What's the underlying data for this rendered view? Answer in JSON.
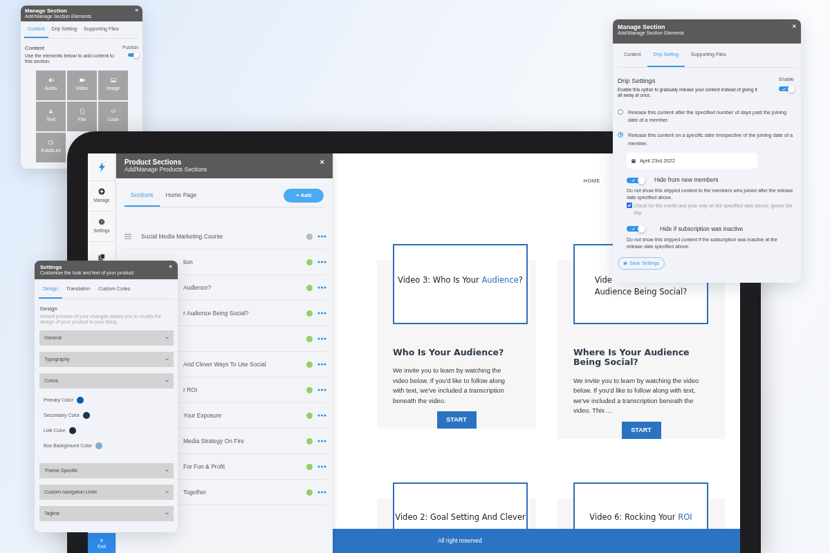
{
  "manage_section_small": {
    "title": "Manage Section",
    "subtitle": "Add/Manage Section Elements",
    "close": "×",
    "tabs": [
      {
        "label": "Content",
        "selected": true
      },
      {
        "label": "Drip Setting",
        "selected": false
      },
      {
        "label": "Supporting Files",
        "selected": false
      }
    ],
    "heading": "Content",
    "description": "Use the elements below to add content to this section.",
    "publish_label": "Publish",
    "published": true,
    "elements": [
      {
        "label": "Audio",
        "kind": "audio"
      },
      {
        "label": "Video",
        "kind": "video"
      },
      {
        "label": "Image",
        "kind": "image"
      },
      {
        "label": "Text",
        "kind": "text",
        "glyph": "A"
      },
      {
        "label": "File",
        "kind": "file"
      },
      {
        "label": "Code",
        "kind": "code"
      },
      {
        "label": "KuickList",
        "kind": "kuicklist"
      }
    ]
  },
  "app_sidebar": {
    "items": [
      {
        "label": "Manage",
        "kind": "manage"
      },
      {
        "label": "Settings",
        "kind": "settings"
      },
      {
        "kind": "pages"
      }
    ],
    "exit": {
      "icon": "×",
      "label": "Exit"
    }
  },
  "product_sections": {
    "title": "Product Sections",
    "subtitle": "Add/Manage Products Sections",
    "close": "×",
    "tabs": [
      {
        "label": "Sections",
        "selected": true
      },
      {
        "label": "Home Page",
        "selected": false
      }
    ],
    "add_button": "+ Add",
    "rows": [
      {
        "text": "Social Media Marketing Course",
        "handle": true,
        "color": "#b9b9b9"
      },
      {
        "text": "tion",
        "handle": false,
        "color": "#8fd16a"
      },
      {
        "text": "Audience?",
        "handle": false,
        "color": "#8fd16a"
      },
      {
        "text": "r Audience Being Social?",
        "handle": false,
        "color": "#8fd16a"
      },
      {
        "handle": false,
        "color": "#8fd16a"
      },
      {
        "text": "And Clever Ways To Use Social",
        "handle": false,
        "color": "#8fd16a"
      },
      {
        "text": "r ROI",
        "handle": false,
        "color": "#8fd16a"
      },
      {
        "text": "Your Exposure",
        "handle": false,
        "color": "#8fd16a"
      },
      {
        "text": "Media Strategy On Fire",
        "handle": false,
        "color": "#8fd16a"
      },
      {
        "text": "For Fun & Profit",
        "handle": false,
        "color": "#8fd16a"
      },
      {
        "text": "Together",
        "handle": false,
        "color": "#8fd16a"
      }
    ]
  },
  "site": {
    "nav": [
      "HOME"
    ],
    "cards": [
      {
        "video_title": [
          [
            {
              "text": "Video 3: Who Is Your "
            },
            {
              "text": "Audience",
              "link": true
            },
            {
              "text": "?"
            }
          ]
        ],
        "title": "Who Is Your Audience?",
        "body": "We invite you to learn by watching the video below. If you'd like to follow along with text, we've included a transcription beneath the video.",
        "button": "START"
      },
      {
        "video_title": [
          [
            {
              "text": "Vide"
            }
          ],
          [
            {
              "text": "Audience Being Social?"
            }
          ]
        ],
        "title": "Where Is Your Audience Being Social?",
        "body": "We invite you to learn by watching the video below. If you'd like to follow along with text, we've included a transcription beneath the video. This ...",
        "button": "START"
      }
    ],
    "more_cards": [
      {
        "video_title": [
          [
            {
              "text": "Video 2: Goal Setting And Clever"
            }
          ]
        ]
      },
      {
        "video_title": [
          [
            {
              "text": "Video 6: Rocking Your "
            },
            {
              "text": "ROI",
              "link": true
            }
          ]
        ]
      }
    ],
    "footer": "All right reserved"
  },
  "settings_panel": {
    "title": "Settings",
    "subtitle": "Customize the look and feel of your product",
    "close": "×",
    "tabs": [
      {
        "label": "Design",
        "selected": true
      },
      {
        "label": "Translation",
        "selected": false
      },
      {
        "label": "Custom Codes",
        "selected": false
      }
    ],
    "heading": "Design",
    "description": "Instant preview of your changes allows you to modify the design of your product to your liking.",
    "sections": [
      {
        "label": "General"
      },
      {
        "label": "Typography"
      },
      {
        "label": "Colors",
        "colors": [
          {
            "label": "Primary Color",
            "color": "#0b5cb5"
          },
          {
            "label": "Secondary Color",
            "color": "#1e3450"
          },
          {
            "label": "Link Color",
            "color": "#1c2a3a"
          },
          {
            "label": "Box Background Color",
            "color": "#82abd2"
          }
        ]
      },
      {
        "label": "Theme Specific"
      },
      {
        "label": "Custom navigation Links"
      },
      {
        "label": "Tagline"
      }
    ]
  },
  "drip_panel": {
    "title": "Manage Section",
    "subtitle": "Add/Manage Section Elements",
    "close": "×",
    "tabs": [
      {
        "label": "Content",
        "selected": false
      },
      {
        "label": "Drip Setting",
        "selected": true
      },
      {
        "label": "Supporting Files",
        "selected": false
      }
    ],
    "heading": "Drip Settings",
    "description": "Enable this option to gradually release your content instead of giving it all away at once.",
    "enable_label": "Enable",
    "enabled": true,
    "options": [
      {
        "label": "Release this content after the specified number of days past the joining date of a member.",
        "selected": false
      },
      {
        "label": "Release this content on a specific date irrespective of the joining date of a member.",
        "selected": true
      }
    ],
    "date": "April 23rd 2022",
    "toggles": [
      {
        "label": "Hide from new members",
        "on": true,
        "description": "Do not show this dripped content to the members who joined after the release date specified above.",
        "checkbox": {
          "label": "Check for the month and year only on the specified date above; ignore the day.",
          "checked": true
        }
      },
      {
        "label": "Hide if subscription was inactive",
        "on": true,
        "description": "Do not show this dripped content if the subscription was inactive at the release date specified above."
      }
    ],
    "save_button": "Save Settings"
  }
}
